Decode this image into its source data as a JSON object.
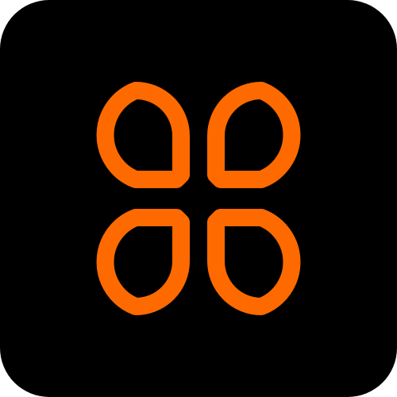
{
  "icon": {
    "name": "four-petal-grid-icon",
    "background_color": "#000000",
    "accent_color": "#FF6A00",
    "petals": [
      "petal-top-left",
      "petal-top-right",
      "petal-bottom-left",
      "petal-bottom-right"
    ]
  }
}
